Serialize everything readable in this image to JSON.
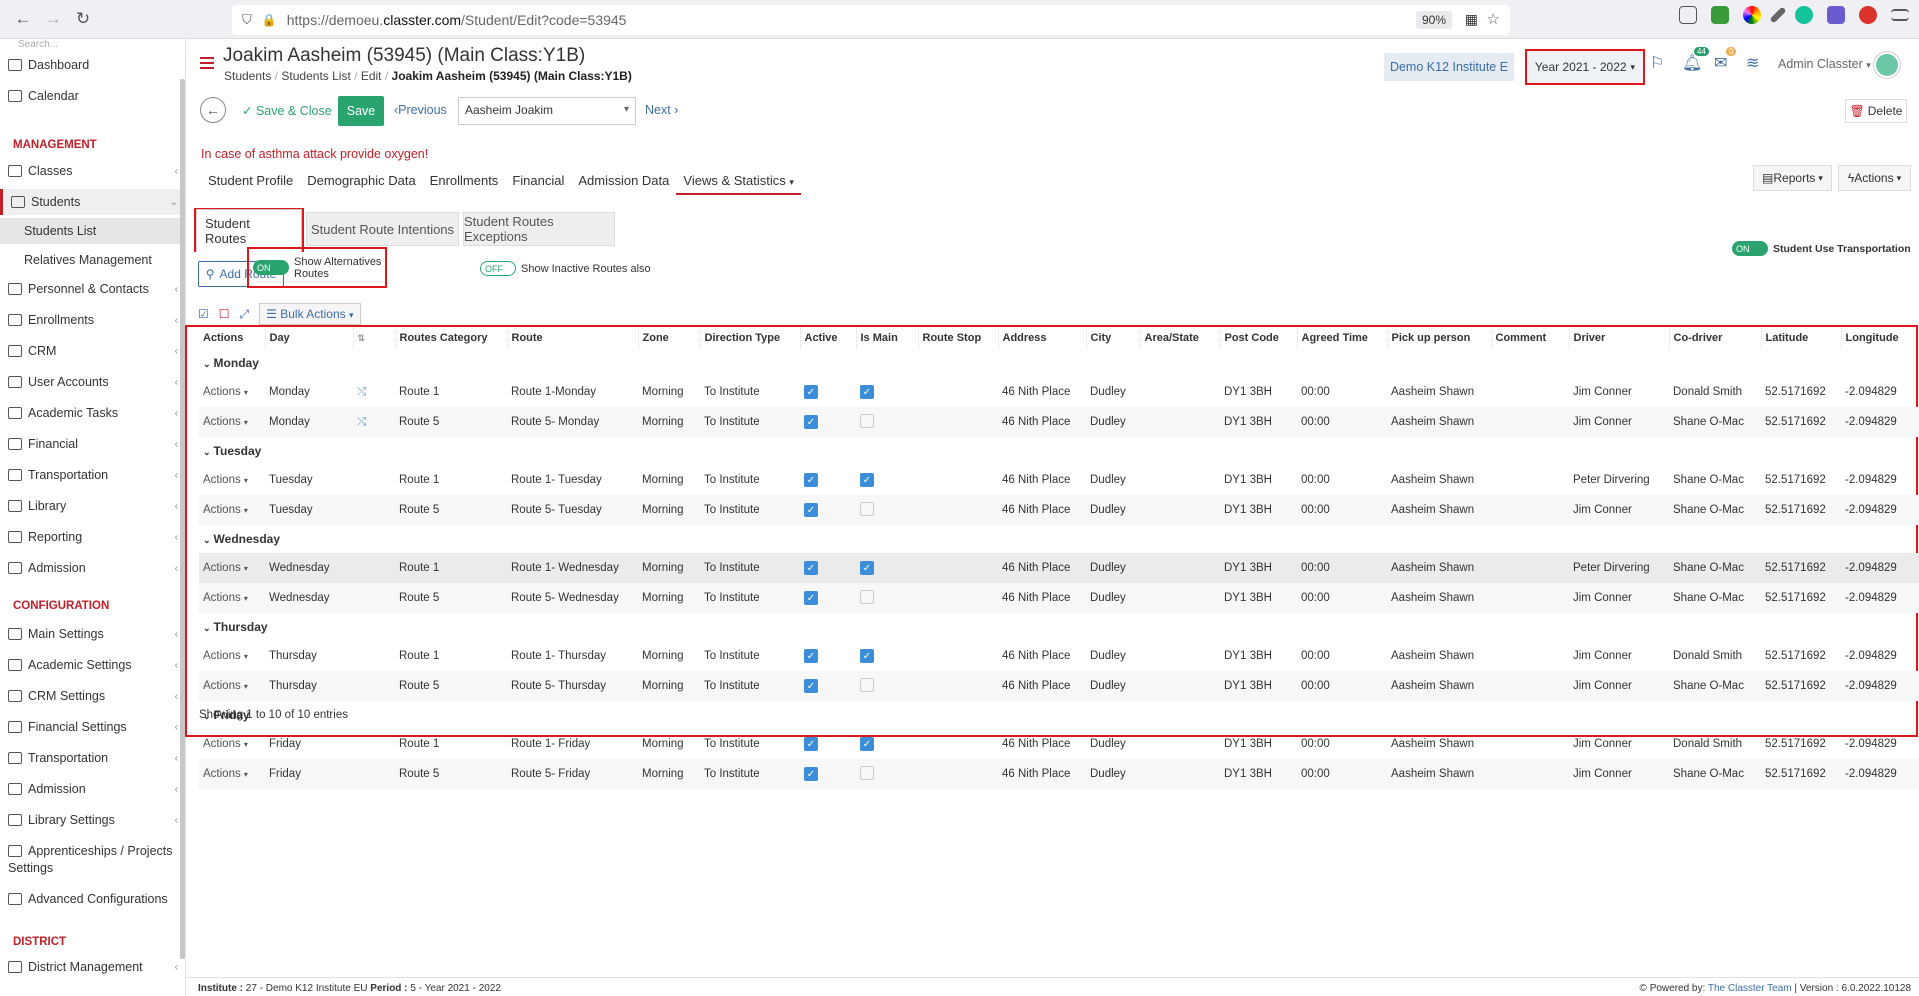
{
  "browser": {
    "url_prefix": "https://demoeu.",
    "url_domain": "classter.com",
    "url_path": "/Student/Edit?code=53945",
    "zoom": "90%"
  },
  "sidebar": {
    "search_placeholder": "Search...",
    "items": [
      {
        "label": "Dashboard",
        "icon": "monitor-icon"
      },
      {
        "label": "Calendar",
        "icon": "calendar-icon"
      }
    ],
    "management_head": "MANAGEMENT",
    "management": [
      {
        "label": "Classes",
        "icon": "classes-icon"
      },
      {
        "label": "Students",
        "icon": "students-icon"
      },
      {
        "label": "Students List",
        "icon": ""
      },
      {
        "label": "Relatives Management",
        "icon": ""
      },
      {
        "label": "Personnel & Contacts",
        "icon": "personnel-icon"
      },
      {
        "label": "Enrollments",
        "icon": "enrollments-icon"
      },
      {
        "label": "CRM",
        "icon": "crm-icon"
      },
      {
        "label": "User Accounts",
        "icon": "user-accounts-icon"
      },
      {
        "label": "Academic Tasks",
        "icon": "academic-tasks-icon"
      },
      {
        "label": "Financial",
        "icon": "financial-icon"
      },
      {
        "label": "Transportation",
        "icon": "transportation-icon"
      },
      {
        "label": "Library",
        "icon": "library-icon"
      },
      {
        "label": "Reporting",
        "icon": "reporting-icon"
      },
      {
        "label": "Admission",
        "icon": "admission-icon"
      }
    ],
    "config_head": "CONFIGURATION",
    "config": [
      {
        "label": "Main Settings",
        "icon": "main-settings-icon"
      },
      {
        "label": "Academic Settings",
        "icon": "academic-settings-icon"
      },
      {
        "label": "CRM Settings",
        "icon": "crm-settings-icon"
      },
      {
        "label": "Financial Settings",
        "icon": "financial-settings-icon"
      },
      {
        "label": "Transportation",
        "icon": "transportation-settings-icon"
      },
      {
        "label": "Admission",
        "icon": "admission-settings-icon"
      },
      {
        "label": "Library Settings",
        "icon": "library-settings-icon"
      },
      {
        "label": "Apprenticeships / Projects",
        "icon": "apprenticeships-icon"
      },
      {
        "label": "Settings",
        "icon": ""
      },
      {
        "label": "Advanced Configurations",
        "icon": "advanced-config-icon"
      }
    ],
    "district_head": "DISTRICT",
    "district": [
      {
        "label": "District Management",
        "icon": "district-icon"
      }
    ]
  },
  "header": {
    "title": "Joakim Aasheim (53945) (Main Class:Y1B)",
    "breadcrumb": [
      "Students",
      "Students List",
      "Edit",
      "Joakim Aasheim (53945) (Main Class:Y1B)"
    ],
    "institute": "Demo K12 Institute E",
    "year": "Year 2021 - 2022",
    "notif_count": "44",
    "msg_count": "0",
    "admin": "Admin Classter"
  },
  "toolbar": {
    "save_close": "Save & Close",
    "save": "Save",
    "previous": "Previous",
    "student_select": "Aasheim Joakim",
    "next": "Next",
    "delete": "Delete"
  },
  "alert": "In case of asthma attack provide oxygen!",
  "tabs": [
    "Student Profile",
    "Demographic Data",
    "Enrollments",
    "Financial",
    "Admission Data",
    "Views & Statistics"
  ],
  "reports": "Reports",
  "actions": "Actions",
  "subtabs": [
    "Student Routes",
    "Student Route Intentions",
    "Student Routes Exceptions"
  ],
  "add_route": "Add Route",
  "toggles": {
    "on": "ON",
    "off": "OFF",
    "alt": "Show Alternatives Routes",
    "inactive": "Show Inactive Routes also",
    "use_trans": "Student Use Transportation"
  },
  "bulk": "Bulk Actions",
  "columns": [
    "Actions",
    "Day",
    "",
    "Routes Category",
    "Route",
    "Zone",
    "Direction Type",
    "Active",
    "Is Main",
    "Route Stop",
    "Address",
    "City",
    "Area/State",
    "Post Code",
    "Agreed Time",
    "Pick up person",
    "Comment",
    "Driver",
    "Co-driver",
    "Latitude",
    "Longitude"
  ],
  "groups": [
    {
      "day": "Monday",
      "rows": [
        {
          "day": "Monday",
          "cat": "Route 1",
          "route": "Route 1-Monday",
          "zone": "Morning",
          "dir": "To Institute",
          "active": true,
          "main": true,
          "addr": "46 Nith Place",
          "city": "Dudley",
          "post": "DY1 3BH",
          "time": "00:00",
          "pickup": "Aasheim Shawn",
          "driver": "Jim Conner",
          "codriver": "Donald Smith",
          "lat": "52.5171692",
          "lon": "-2.094829",
          "alt": true
        },
        {
          "day": "Monday",
          "cat": "Route 5",
          "route": "Route 5- Monday",
          "zone": "Morning",
          "dir": "To Institute",
          "active": true,
          "main": false,
          "addr": "46 Nith Place",
          "city": "Dudley",
          "post": "DY1 3BH",
          "time": "00:00",
          "pickup": "Aasheim Shawn",
          "driver": "Jim Conner",
          "codriver": "Shane O-Mac",
          "lat": "52.5171692",
          "lon": "-2.094829",
          "alt": true
        }
      ]
    },
    {
      "day": "Tuesday",
      "rows": [
        {
          "day": "Tuesday",
          "cat": "Route 1",
          "route": "Route 1- Tuesday",
          "zone": "Morning",
          "dir": "To Institute",
          "active": true,
          "main": true,
          "addr": "46 Nith Place",
          "city": "Dudley",
          "post": "DY1 3BH",
          "time": "00:00",
          "pickup": "Aasheim Shawn",
          "driver": "Peter Dirvering",
          "codriver": "Shane O-Mac",
          "lat": "52.5171692",
          "lon": "-2.094829",
          "alt": false
        },
        {
          "day": "Tuesday",
          "cat": "Route 5",
          "route": "Route 5- Tuesday",
          "zone": "Morning",
          "dir": "To Institute",
          "active": true,
          "main": false,
          "addr": "46 Nith Place",
          "city": "Dudley",
          "post": "DY1 3BH",
          "time": "00:00",
          "pickup": "Aasheim Shawn",
          "driver": "Jim Conner",
          "codriver": "Shane O-Mac",
          "lat": "52.5171692",
          "lon": "-2.094829",
          "alt": false
        }
      ]
    },
    {
      "day": "Wednesday",
      "rows": [
        {
          "day": "Wednesday",
          "cat": "Route 1",
          "route": "Route 1- Wednesday",
          "zone": "Morning",
          "dir": "To Institute",
          "active": true,
          "main": true,
          "addr": "46 Nith Place",
          "city": "Dudley",
          "post": "DY1 3BH",
          "time": "00:00",
          "pickup": "Aasheim Shawn",
          "driver": "Peter Dirvering",
          "codriver": "Shane O-Mac",
          "lat": "52.5171692",
          "lon": "-2.094829",
          "alt": false
        },
        {
          "day": "Wednesday",
          "cat": "Route 5",
          "route": "Route 5- Wednesday",
          "zone": "Morning",
          "dir": "To Institute",
          "active": true,
          "main": false,
          "addr": "46 Nith Place",
          "city": "Dudley",
          "post": "DY1 3BH",
          "time": "00:00",
          "pickup": "Aasheim Shawn",
          "driver": "Jim Conner",
          "codriver": "Shane O-Mac",
          "lat": "52.5171692",
          "lon": "-2.094829",
          "alt": false
        }
      ]
    },
    {
      "day": "Thursday",
      "rows": [
        {
          "day": "Thursday",
          "cat": "Route 1",
          "route": "Route 1- Thursday",
          "zone": "Morning",
          "dir": "To Institute",
          "active": true,
          "main": true,
          "addr": "46 Nith Place",
          "city": "Dudley",
          "post": "DY1 3BH",
          "time": "00:00",
          "pickup": "Aasheim Shawn",
          "driver": "Jim Conner",
          "codriver": "Donald Smith",
          "lat": "52.5171692",
          "lon": "-2.094829",
          "alt": false
        },
        {
          "day": "Thursday",
          "cat": "Route 5",
          "route": "Route 5- Thursday",
          "zone": "Morning",
          "dir": "To Institute",
          "active": true,
          "main": false,
          "addr": "46 Nith Place",
          "city": "Dudley",
          "post": "DY1 3BH",
          "time": "00:00",
          "pickup": "Aasheim Shawn",
          "driver": "Jim Conner",
          "codriver": "Shane O-Mac",
          "lat": "52.5171692",
          "lon": "-2.094829",
          "alt": false
        }
      ]
    },
    {
      "day": "Friday",
      "rows": [
        {
          "day": "Friday",
          "cat": "Route 1",
          "route": "Route 1- Friday",
          "zone": "Morning",
          "dir": "To Institute",
          "active": true,
          "main": true,
          "addr": "46 Nith Place",
          "city": "Dudley",
          "post": "DY1 3BH",
          "time": "00:00",
          "pickup": "Aasheim Shawn",
          "driver": "Jim Conner",
          "codriver": "Donald Smith",
          "lat": "52.5171692",
          "lon": "-2.094829",
          "alt": false
        },
        {
          "day": "Friday",
          "cat": "Route 5",
          "route": "Route 5- Friday",
          "zone": "Morning",
          "dir": "To Institute",
          "active": true,
          "main": false,
          "addr": "46 Nith Place",
          "city": "Dudley",
          "post": "DY1 3BH",
          "time": "00:00",
          "pickup": "Aasheim Shawn",
          "driver": "Jim Conner",
          "codriver": "Shane O-Mac",
          "lat": "52.5171692",
          "lon": "-2.094829",
          "alt": false
        }
      ]
    }
  ],
  "actions_cell": "Actions",
  "showing": "Showing 1 to 10 of 10 entries",
  "footer": {
    "inst_label": "Institute :",
    "inst": "27 - Demo K12 Institute EU",
    "period_label": "Period :",
    "period": "5 - Year 2021 - 2022",
    "powered": "Powered by:",
    "team": "The Classter Team",
    "version": "| Version : 6.0.2022.10128"
  }
}
